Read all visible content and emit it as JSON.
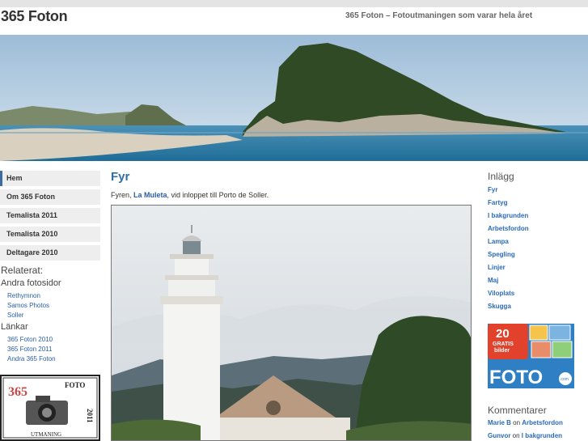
{
  "header": {
    "title": "365 Foton",
    "description": "365 Foton – Fotoutmaningen som varar hela året"
  },
  "nav": {
    "items": [
      {
        "label": "Hem"
      },
      {
        "label": "Om 365 Foton"
      },
      {
        "label": "Temalista 2011"
      },
      {
        "label": "Temalista 2010"
      },
      {
        "label": "Deltagare 2010"
      }
    ]
  },
  "sidebar_left": {
    "related_heading": "Relaterat:",
    "other_sites_heading": "Andra fotosidor",
    "other_sites": [
      "Rethymnon",
      "Samos Photos",
      "Soller"
    ],
    "links_heading": "Länkar",
    "links": [
      "365 Foton 2010",
      "365 Foton 2011",
      "Andra 365 Foton"
    ],
    "logo": {
      "text_top": "FOTO",
      "year": "2011",
      "numbers": "365",
      "bottom": "UTMANING"
    }
  },
  "post": {
    "title": "Fyr",
    "text_before": "Fyren, ",
    "link_text": "La Muleta",
    "text_after": ", vid inloppet till Porto de Soller."
  },
  "sidebar_right": {
    "posts_heading": "Inlägg",
    "posts": [
      "Fyr",
      "Fartyg",
      "I bakgrunden",
      "Arbetsfordon",
      "Lampa",
      "Spegling",
      "Linjer",
      "Maj",
      "Viloplats",
      "Skugga"
    ],
    "ad": {
      "number": "20",
      "line1": "GRATIS",
      "line2": "bilder",
      "brand": "FOTO",
      "badge": ".com"
    },
    "comments_heading": "Kommentarer",
    "comments": [
      {
        "author": "Marie B",
        "on": " on ",
        "post": "Arbetsfordon"
      },
      {
        "author": "Gunvor",
        "on": " on ",
        "post": "I bakgrunden"
      }
    ]
  },
  "colors": {
    "accent": "#2f6ea8",
    "link": "#2a6ab8",
    "nav_bg": "#eeeeee",
    "topbar": "#e4e4e4"
  }
}
